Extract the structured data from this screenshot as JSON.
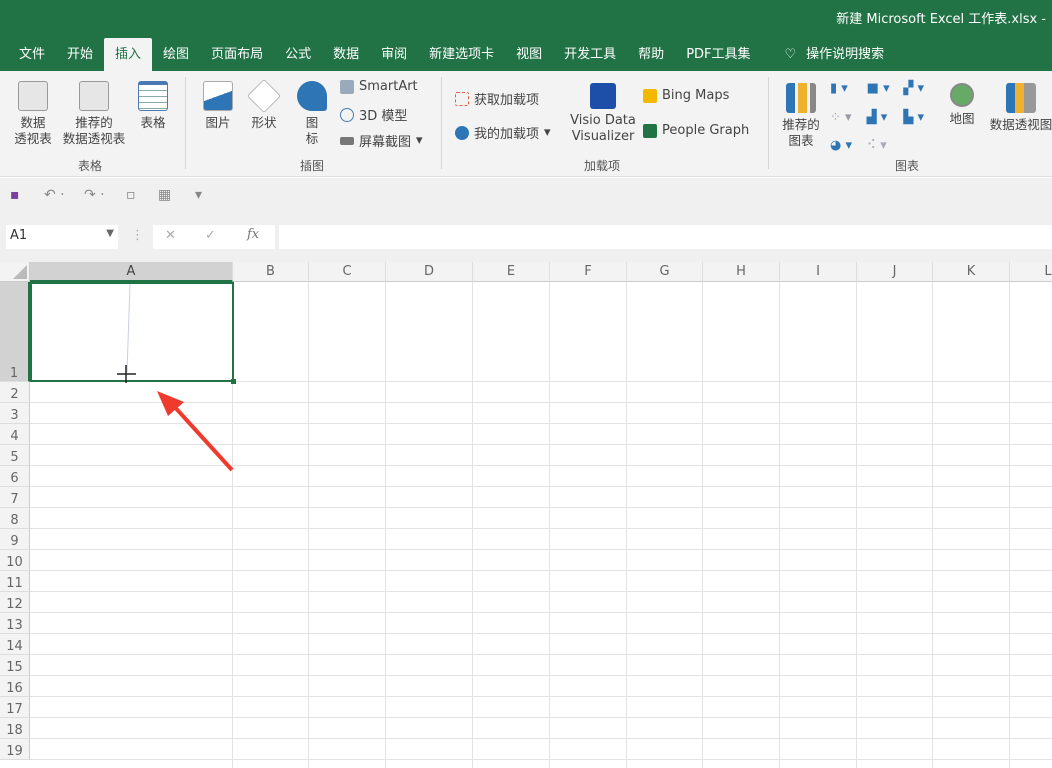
{
  "window": {
    "title": "新建 Microsoft Excel 工作表.xlsx  -"
  },
  "tabs": [
    {
      "label": "文件"
    },
    {
      "label": "开始"
    },
    {
      "label": "插入",
      "active": true
    },
    {
      "label": "绘图"
    },
    {
      "label": "页面布局"
    },
    {
      "label": "公式"
    },
    {
      "label": "数据"
    },
    {
      "label": "审阅"
    },
    {
      "label": "新建选项卡"
    },
    {
      "label": "视图"
    },
    {
      "label": "开发工具"
    },
    {
      "label": "帮助"
    },
    {
      "label": "PDF工具集"
    }
  ],
  "tell_me": {
    "icon": "lightbulb-icon",
    "label": "操作说明搜索"
  },
  "ribbon": {
    "tables": {
      "group": "表格",
      "pivot": "数据\n透视表",
      "recommended_pivot": "推荐的\n数据透视表",
      "table": "表格"
    },
    "illustrations": {
      "group": "插图",
      "pictures": "图片",
      "shapes": "形状",
      "icons": "图\n标",
      "smartart": "SmartArt",
      "model3d": "3D 模型",
      "screenshot": "屏幕截图"
    },
    "addins": {
      "group": "加载项",
      "get": "获取加载项",
      "my": "我的加载项",
      "visio": "Visio Data\nVisualizer",
      "bing": "Bing Maps",
      "people": "People Graph"
    },
    "charts": {
      "group": "图表",
      "recommended": "推荐的\n图表",
      "maps": "地图",
      "pivot_chart": "数据透视图"
    }
  },
  "formula_bar": {
    "name_box": "A1",
    "cancel": "✕",
    "enter": "✓",
    "fx": "fx",
    "value": ""
  },
  "grid": {
    "columns": [
      "A",
      "B",
      "C",
      "D",
      "E",
      "F",
      "G",
      "H",
      "I",
      "J",
      "K",
      "L"
    ],
    "rows": [
      "1",
      "2",
      "3",
      "4",
      "5",
      "6",
      "7",
      "8",
      "9",
      "10",
      "11",
      "12",
      "13",
      "14",
      "15",
      "16",
      "17",
      "18",
      "19"
    ],
    "selected": "A1"
  },
  "colors": {
    "accent": "#217346",
    "arrow": "#f03a2e"
  }
}
